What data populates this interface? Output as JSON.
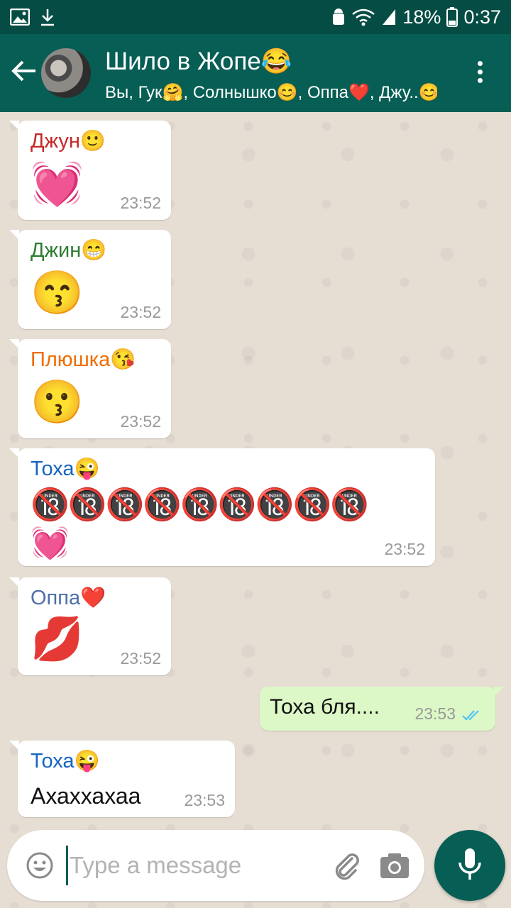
{
  "status_bar": {
    "battery": "18%",
    "time": "0:37",
    "left_icons": [
      "image-icon",
      "download-icon"
    ],
    "right_icons": [
      "android-icon",
      "wifi-icon",
      "signal-icon",
      "battery-icon"
    ]
  },
  "header": {
    "title": "Шило в Жопе😂",
    "subtitle": "Вы, Гук🤗, Солнышко😊, Оппа❤️, Джу..😊",
    "colors": {
      "header": "#075e54",
      "status": "#054d44"
    }
  },
  "messages": [
    {
      "sender": "Джун🙂",
      "sender_color": "#c62828",
      "content": "💓",
      "time": "23:52"
    },
    {
      "sender": "Джин😁",
      "sender_color": "#2e7d32",
      "content": "😙",
      "time": "23:52"
    },
    {
      "sender": "Плюшка😘",
      "sender_color": "#ef6c00",
      "content": "😗",
      "time": "23:52"
    },
    {
      "sender": "Тоха😜",
      "sender_color": "#1565c0",
      "content_line1": "🔞🔞🔞🔞🔞🔞🔞🔞🔞",
      "content_line2": "💓",
      "time": "23:52"
    },
    {
      "sender": "Оппа❤️",
      "sender_color": "#4e6fa8",
      "content": "💋",
      "time": "23:52"
    },
    {
      "text": "Тоха бля....",
      "time": "23:53",
      "outgoing": true,
      "status": "read"
    },
    {
      "sender": "Тоха😜",
      "sender_color": "#1565c0",
      "text": "Ахаххахаа",
      "time": "23:53"
    }
  ],
  "composer": {
    "placeholder": "Type a message",
    "icons": [
      "emoji-icon",
      "paperclip-icon",
      "camera-icon",
      "microphone-icon"
    ]
  }
}
